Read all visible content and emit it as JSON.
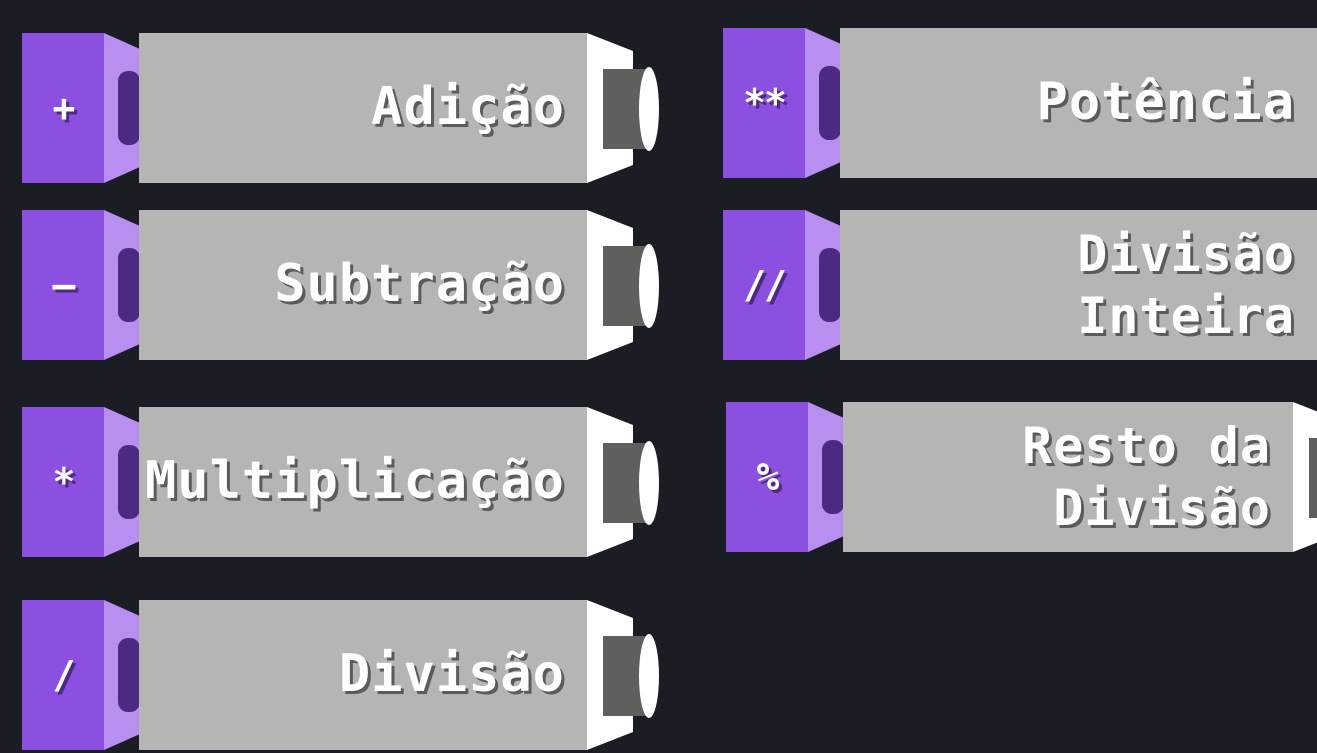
{
  "operators": [
    {
      "symbol": "+",
      "label_lines": [
        "Adição"
      ]
    },
    {
      "symbol": "–",
      "label_lines": [
        "Subtração"
      ]
    },
    {
      "symbol": "*",
      "label_lines": [
        "Multiplicação"
      ]
    },
    {
      "symbol": "/",
      "label_lines": [
        "Divisão"
      ]
    },
    {
      "symbol": "**",
      "label_lines": [
        "Potência"
      ]
    },
    {
      "symbol": "//",
      "label_lines": [
        "Divisão",
        "Inteira"
      ]
    },
    {
      "symbol": "%",
      "label_lines": [
        "Resto da",
        "Divisão"
      ]
    }
  ],
  "colors": {
    "background": "#1b1d25",
    "cap_purple": "#8b50df",
    "neck_light_purple": "#b88ef0",
    "neck_dark_purple": "#4a2a82",
    "body_gray": "#b5b6b3",
    "tip_white": "#ffffff",
    "tip_dark_gray": "#5f605d"
  }
}
